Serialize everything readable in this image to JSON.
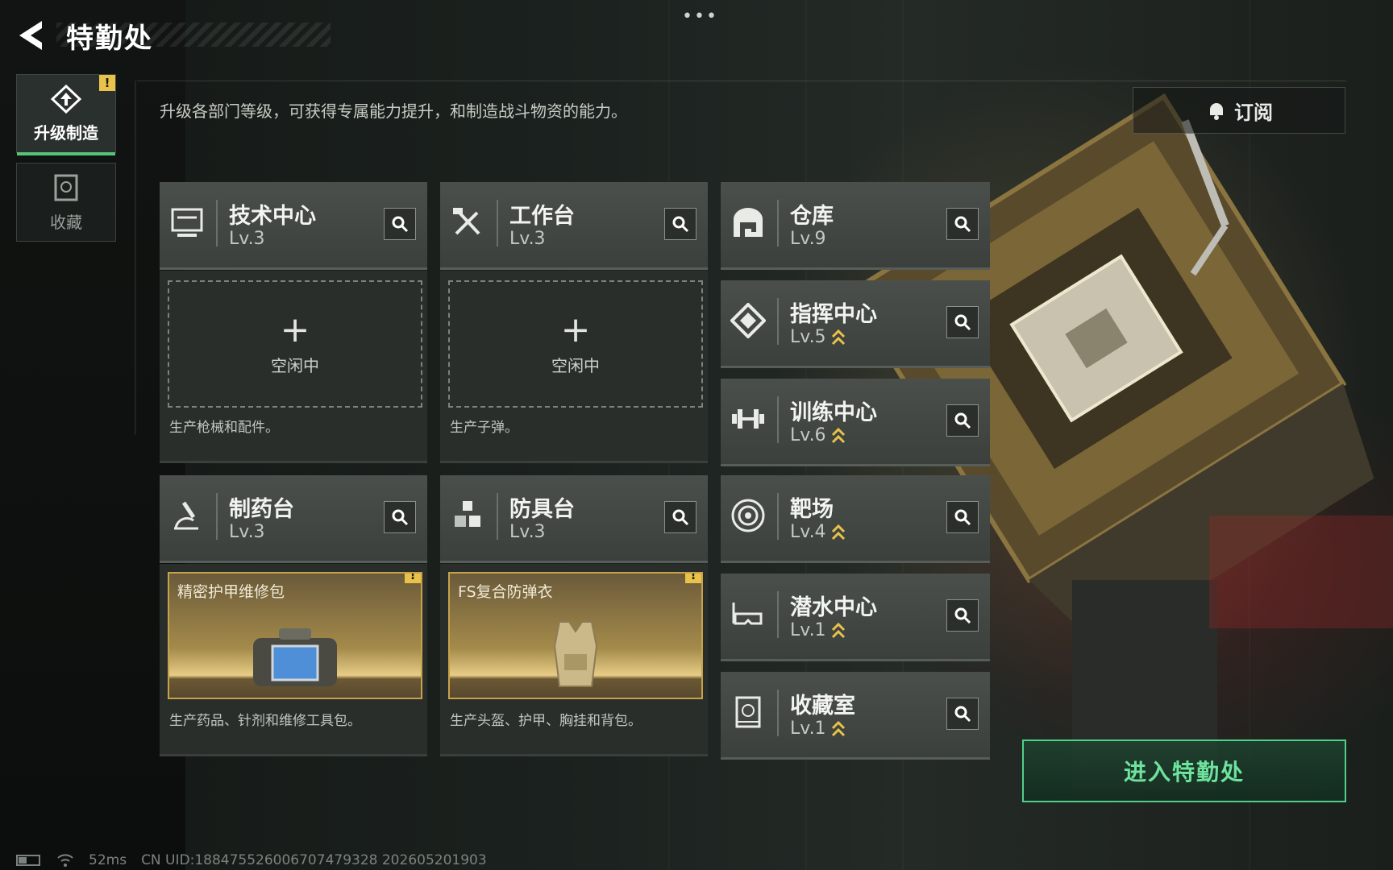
{
  "header": {
    "title": "特勤处",
    "subtitle": "升级各部门等级，可获得专属能力提升，和制造战斗物资的能力。",
    "subscribe_label": "订阅",
    "more_label": "•••"
  },
  "sidebar": {
    "tabs": [
      {
        "label": "升级制造",
        "icon": "upgrade-icon",
        "active": true,
        "badge": "!"
      },
      {
        "label": "收藏",
        "icon": "collection-icon",
        "active": false
      }
    ]
  },
  "departments": {
    "tech": {
      "name": "技术中心",
      "level": "Lv.3",
      "icon": "monitor-icon",
      "slot_state": "空闲中",
      "desc": "生产枪械和配件。"
    },
    "workbench": {
      "name": "工作台",
      "level": "Lv.3",
      "icon": "tools-icon",
      "slot_state": "空闲中",
      "desc": "生产子弹。"
    },
    "pharmacy": {
      "name": "制药台",
      "level": "Lv.3",
      "icon": "microscope-icon",
      "item": "精密护甲维修包",
      "badge": "!",
      "desc": "生产药品、针剂和维修工具包。"
    },
    "armor": {
      "name": "防具台",
      "level": "Lv.3",
      "icon": "blocks-icon",
      "item": "FS复合防弹衣",
      "badge": "!",
      "desc": "生产头盔、护甲、胸挂和背包。"
    },
    "warehouse": {
      "name": "仓库",
      "level": "Lv.9",
      "icon": "warehouse-icon"
    },
    "command": {
      "name": "指挥中心",
      "level": "Lv.5",
      "icon": "command-icon",
      "upgradable": true
    },
    "training": {
      "name": "训练中心",
      "level": "Lv.6",
      "icon": "dumbbell-icon",
      "upgradable": true
    },
    "range": {
      "name": "靶场",
      "level": "Lv.4",
      "icon": "target-icon",
      "upgradable": true
    },
    "diving": {
      "name": "潜水中心",
      "level": "Lv.1",
      "icon": "diving-mask-icon",
      "upgradable": true
    },
    "collection": {
      "name": "收藏室",
      "level": "Lv.1",
      "icon": "collection-room-icon",
      "upgradable": true
    }
  },
  "enter_button": "进入特勤处",
  "footer": {
    "ping": "52ms",
    "uid": "CN UID:1884755260067074793​28 202605201903"
  },
  "colors": {
    "accent_green": "#4fd08a",
    "gold": "#e9c24a",
    "panel": "#3b403c"
  }
}
